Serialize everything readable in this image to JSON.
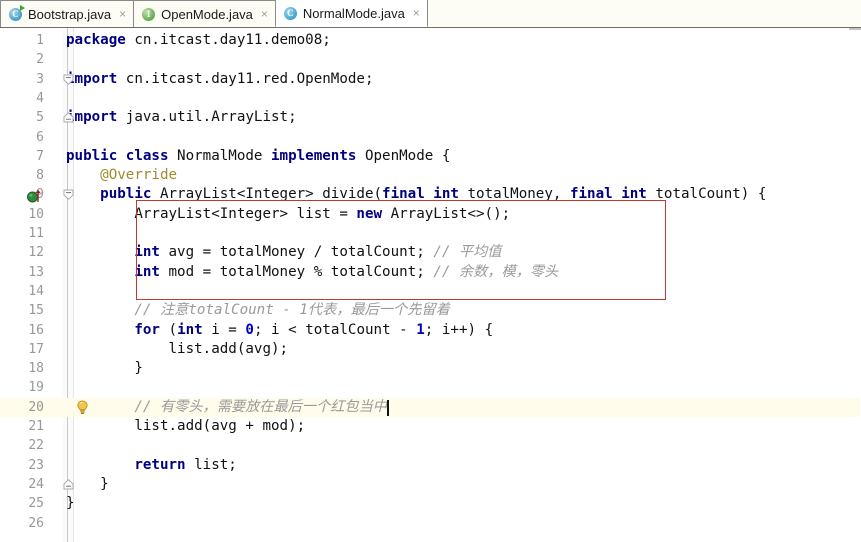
{
  "window": {
    "app": "IntelliJ IDEA Java Editor",
    "active_file": "NormalMode.java"
  },
  "tabs": [
    {
      "label": "Bootstrap.java",
      "icon": "java-class-runnable-icon",
      "close": "×",
      "active": false
    },
    {
      "label": "OpenMode.java",
      "icon": "java-interface-icon",
      "close": "×",
      "active": false
    },
    {
      "label": "NormalMode.java",
      "icon": "java-class-icon",
      "close": "×",
      "active": true
    }
  ],
  "editor": {
    "language": "Java",
    "caret_line": 20,
    "current_line_highlight_color": "#fffceb",
    "annotation_box_color": "#c0392b",
    "gutter_icons": [
      {
        "line": 9,
        "icon": "implementing-method-override-icon"
      },
      {
        "line": 20,
        "icon": "intention-bulb-icon"
      }
    ],
    "fold_markers": [
      {
        "line": 3,
        "icon": "fold-expanded-icon"
      },
      {
        "line": 5,
        "icon": "fold-collapsed-end-icon"
      },
      {
        "line": 9,
        "icon": "fold-expanded-icon"
      },
      {
        "line": 24,
        "icon": "fold-collapsed-end-icon"
      }
    ],
    "lines": [
      {
        "n": 1,
        "tokens": [
          {
            "t": "package",
            "c": "kw"
          },
          {
            "t": " cn.itcast.day11.demo08;",
            "c": "pl"
          }
        ]
      },
      {
        "n": 2,
        "tokens": []
      },
      {
        "n": 3,
        "tokens": [
          {
            "t": "import",
            "c": "kw"
          },
          {
            "t": " cn.itcast.day11.red.OpenMode;",
            "c": "pl"
          }
        ]
      },
      {
        "n": 4,
        "tokens": []
      },
      {
        "n": 5,
        "tokens": [
          {
            "t": "import",
            "c": "kw"
          },
          {
            "t": " java.util.ArrayList;",
            "c": "pl"
          }
        ]
      },
      {
        "n": 6,
        "tokens": []
      },
      {
        "n": 7,
        "tokens": [
          {
            "t": "public class",
            "c": "kw"
          },
          {
            "t": " NormalMode ",
            "c": "pl"
          },
          {
            "t": "implements",
            "c": "kw"
          },
          {
            "t": " OpenMode {",
            "c": "pl"
          }
        ]
      },
      {
        "n": 8,
        "tokens": [
          {
            "t": "    @Override",
            "c": "an"
          }
        ]
      },
      {
        "n": 9,
        "tokens": [
          {
            "t": "    ",
            "c": "pl"
          },
          {
            "t": "public",
            "c": "kw"
          },
          {
            "t": " ArrayList<Integer> divide(",
            "c": "pl"
          },
          {
            "t": "final int",
            "c": "kw"
          },
          {
            "t": " totalMoney, ",
            "c": "pl"
          },
          {
            "t": "final int",
            "c": "kw"
          },
          {
            "t": " totalCount) {",
            "c": "pl"
          }
        ]
      },
      {
        "n": 10,
        "tokens": [
          {
            "t": "        ArrayList<Integer> list = ",
            "c": "pl"
          },
          {
            "t": "new",
            "c": "kw"
          },
          {
            "t": " ArrayList<>();",
            "c": "pl"
          }
        ]
      },
      {
        "n": 11,
        "tokens": []
      },
      {
        "n": 12,
        "tokens": [
          {
            "t": "        ",
            "c": "pl"
          },
          {
            "t": "int",
            "c": "kw"
          },
          {
            "t": " avg = totalMoney / totalCount; ",
            "c": "pl"
          },
          {
            "t": "// 平均值",
            "c": "cm"
          }
        ]
      },
      {
        "n": 13,
        "tokens": [
          {
            "t": "        ",
            "c": "pl"
          },
          {
            "t": "int",
            "c": "kw"
          },
          {
            "t": " mod = totalMoney % totalCount; ",
            "c": "pl"
          },
          {
            "t": "// 余数，模，零头",
            "c": "cm"
          }
        ]
      },
      {
        "n": 14,
        "tokens": []
      },
      {
        "n": 15,
        "tokens": [
          {
            "t": "        ",
            "c": "pl"
          },
          {
            "t": "// 注意totalCount - 1代表，最后一个先留着",
            "c": "cm"
          }
        ]
      },
      {
        "n": 16,
        "tokens": [
          {
            "t": "        ",
            "c": "pl"
          },
          {
            "t": "for",
            "c": "kw"
          },
          {
            "t": " (",
            "c": "pl"
          },
          {
            "t": "int",
            "c": "kw"
          },
          {
            "t": " i = ",
            "c": "pl"
          },
          {
            "t": "0",
            "c": "num"
          },
          {
            "t": "; i < totalCount - ",
            "c": "pl"
          },
          {
            "t": "1",
            "c": "num"
          },
          {
            "t": "; i++) {",
            "c": "pl"
          }
        ]
      },
      {
        "n": 17,
        "tokens": [
          {
            "t": "            list.add(avg);",
            "c": "pl"
          }
        ]
      },
      {
        "n": 18,
        "tokens": [
          {
            "t": "        }",
            "c": "pl"
          }
        ]
      },
      {
        "n": 19,
        "tokens": []
      },
      {
        "n": 20,
        "tokens": [
          {
            "t": "        ",
            "c": "pl"
          },
          {
            "t": "// 有零头，需要放在最后一个红包当中",
            "c": "cm"
          }
        ]
      },
      {
        "n": 21,
        "tokens": [
          {
            "t": "        list.add(avg + mod);",
            "c": "pl"
          }
        ]
      },
      {
        "n": 22,
        "tokens": []
      },
      {
        "n": 23,
        "tokens": [
          {
            "t": "        ",
            "c": "pl"
          },
          {
            "t": "return",
            "c": "kw"
          },
          {
            "t": " list;",
            "c": "pl"
          }
        ]
      },
      {
        "n": 24,
        "tokens": [
          {
            "t": "    }",
            "c": "pl"
          }
        ]
      },
      {
        "n": 25,
        "tokens": [
          {
            "t": "}",
            "c": "pl"
          }
        ]
      },
      {
        "n": 26,
        "tokens": []
      }
    ]
  }
}
